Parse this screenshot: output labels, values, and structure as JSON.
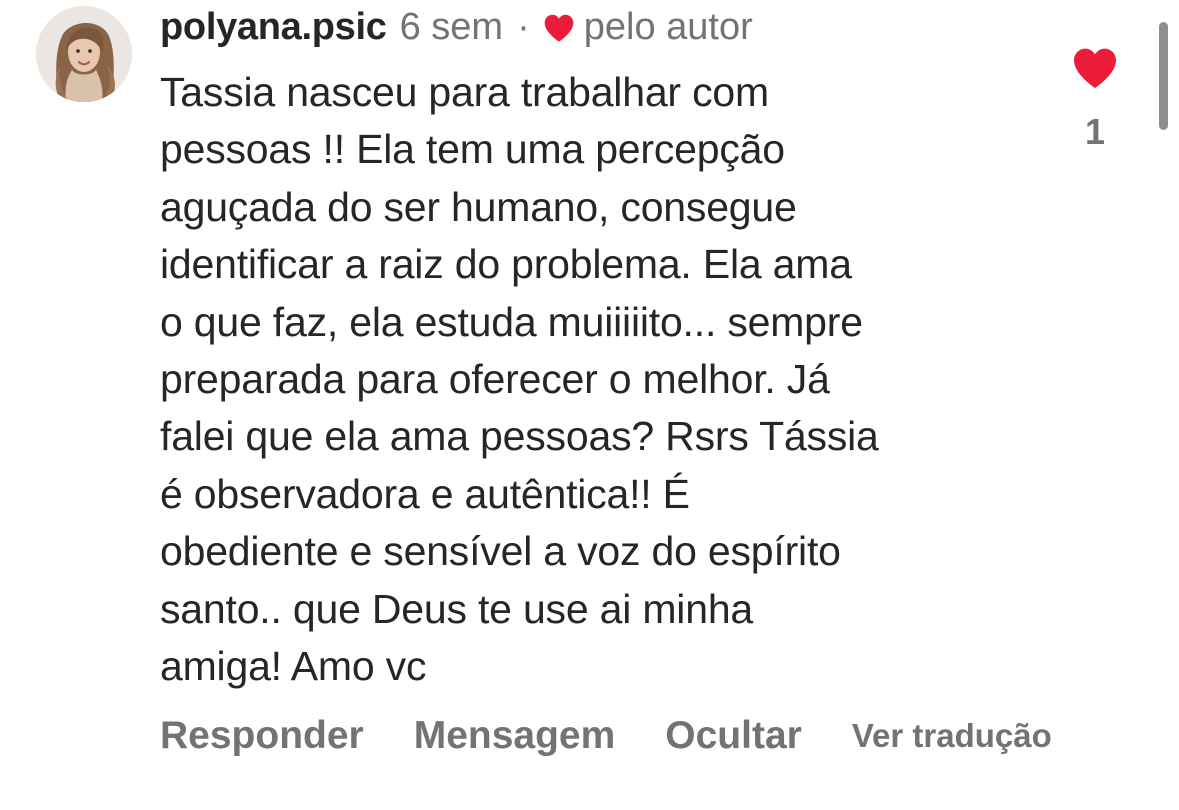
{
  "comment": {
    "username": "polyana.psic",
    "time": "6 sem",
    "separator": "·",
    "author_like_label": "pelo autor",
    "text": "Tassia nasceu para trabalhar com\npessoas !! Ela tem uma percepção\naguçada do ser humano, consegue\nidentificar a raiz do problema. Ela ama\no que faz, ela estuda muiiiiito... sempre\npreparada para oferecer o melhor. Já\nfalei que ela ama pessoas? Rsrs Tássia\né observadora e autêntica!! É\nobediente e sensível a voz do espírito\nsanto.. que Deus te use ai minha\namiga! Amo vc",
    "like_count": "1"
  },
  "actions": {
    "reply": "Responder",
    "message": "Mensagem",
    "hide": "Ocultar",
    "translate": "Ver tradução"
  },
  "colors": {
    "heart": "#ed1b3a",
    "primary_text": "#262626",
    "secondary_text": "#737373",
    "background": "#ffffff"
  },
  "icons": {
    "author_like": "heart-icon",
    "like_button": "heart-filled-icon",
    "avatar": "profile-photo"
  }
}
